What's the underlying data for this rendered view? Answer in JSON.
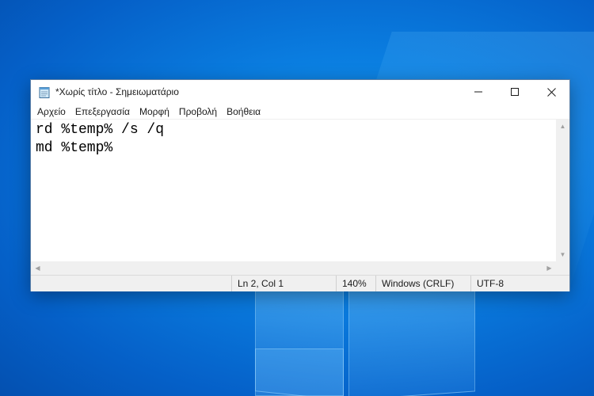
{
  "window": {
    "title": "*Χωρίς τίτλο - Σημειωματάριο",
    "icon": "notepad-icon",
    "controls": {
      "minimize": "—",
      "maximize": "☐",
      "close": "✕"
    }
  },
  "menu": [
    {
      "label": "Αρχείο"
    },
    {
      "label": "Επεξεργασία"
    },
    {
      "label": "Μορφή"
    },
    {
      "label": "Προβολή"
    },
    {
      "label": "Βοήθεια"
    }
  ],
  "editor": {
    "lines": [
      "rd %temp% /s /q",
      "md %temp%"
    ]
  },
  "status": {
    "position": "Ln 2, Col 1",
    "zoom": "140%",
    "line_ending": "Windows (CRLF)",
    "encoding": "UTF-8"
  },
  "colors": {
    "desktop": "#0a7de0",
    "window_border": "#5a7ea6"
  }
}
